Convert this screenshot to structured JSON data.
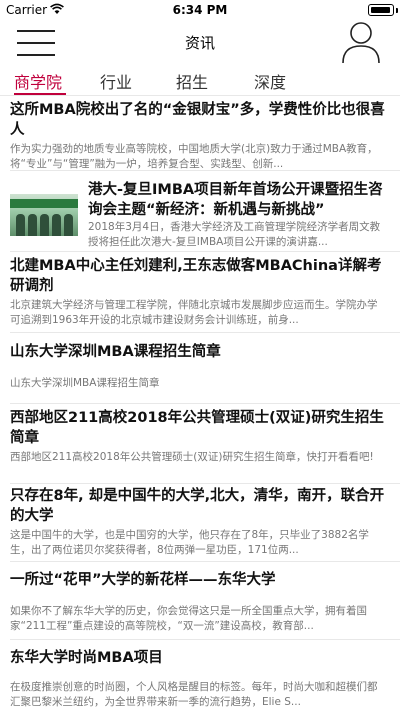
{
  "status_bar": {
    "carrier": "Carrier",
    "time": "6:34 PM",
    "battery_level": 0.95
  },
  "nav": {
    "title": "资讯"
  },
  "tabs": [
    {
      "label": "商学院",
      "active": true
    },
    {
      "label": "行业",
      "active": false
    },
    {
      "label": "招生",
      "active": false
    },
    {
      "label": "深度",
      "active": false
    }
  ],
  "accent_color": "#c0003c",
  "news": [
    {
      "headline": "这所MBA院校出了名的“金银财宝”多，学费性价比也很喜人",
      "summary": "作为实力强劲的地质专业高等院校，中国地质大学(北京)致力于通过MBA教育，将“专业”与“管理”融为一炉，培养复合型、实践型、创新..."
    },
    {
      "headline": "港大-复旦IMBA项目新年首场公开课暨招生咨询会主题“新经济：新机遇与新挑战”",
      "summary": "2018年3月4日，香港大学经济及工商管理学院经济学者周文教授将担任此次港大-复旦IMBA项目公开课的演讲嘉...",
      "has_thumbnail": true
    },
    {
      "headline": "北建MBA中心主任刘建利,王东志做客MBAChina详解考研调剂",
      "summary": "北京建筑大学经济与管理工程学院，伴随北京城市发展脚步应运而生。学院办学可追溯到1963年开设的北京城市建设财务会计训练班，前身..."
    },
    {
      "headline": "山东大学深圳MBA课程招生简章",
      "summary": "山东大学深圳MBA课程招生简章"
    },
    {
      "headline": "西部地区211高校2018年公共管理硕士(双证)研究生招生简章",
      "summary": "西部地区211高校2018年公共管理硕士(双证)研究生招生简章，快打开看看吧!"
    },
    {
      "headline": "只存在8年, 却是中国牛的大学,北大，清华，南开，联合开的大学",
      "summary": "这是中国牛的大学，也是中国穷的大学，他只存在了8年，只毕业了3882名学生，出了两位诺贝尔奖获得者，8位两弹一星功臣，171位两..."
    },
    {
      "headline": "一所过“花甲”大学的新花样——东华大学",
      "summary": "如果你不了解东华大学的历史，你会觉得这只是一所全国重点大学，拥有着国家“211工程”重点建设的高等院校，“双一流”建设高校，教育部..."
    },
    {
      "headline": "东华大学时尚MBA项目",
      "summary": "在极度推崇创意的时尚圈，个人风格是醒目的标签。每年，时尚大咖和超模们都汇聚巴黎米兰纽约，为全世界带来新一季的流行趋势，Elie S..."
    }
  ]
}
